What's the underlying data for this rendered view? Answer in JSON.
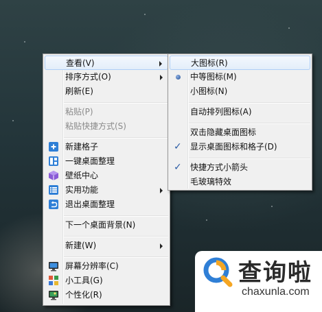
{
  "main_menu": {
    "view": "查看(V)",
    "sort": "排序方式(O)",
    "refresh": "刷新(E)",
    "paste": "粘贴(P)",
    "paste_shortcut": "粘贴快捷方式(S)",
    "new_grid": "新建格子",
    "one_key_organize": "一键桌面整理",
    "wallpaper_center": "壁纸中心",
    "utilities": "实用功能",
    "exit_organize": "退出桌面整理",
    "next_background": "下一个桌面背景(N)",
    "new": "新建(W)",
    "resolution": "屏幕分辨率(C)",
    "gadgets": "小工具(G)",
    "personalize": "个性化(R)"
  },
  "view_submenu": {
    "large_icons": "大图标(R)",
    "medium_icons": "中等图标(M)",
    "small_icons": "小图标(N)",
    "auto_arrange": "自动排列图标(A)",
    "double_click_hide": "双击隐藏桌面图标",
    "show_icons_grids": "显示桌面图标和格子(D)",
    "shortcut_arrow": "快捷方式小箭头",
    "frosted_glass": "毛玻璃特效",
    "checkmark": "✓"
  },
  "watermark": {
    "brand_cn": "查询啦",
    "brand_en": "chaxunla.com"
  },
  "colors": {
    "menu_bg": "#f0f0f0",
    "hover_border": "#aecff7",
    "accent_blue": "#2f7fd6",
    "logo_orange": "#f5a623"
  }
}
